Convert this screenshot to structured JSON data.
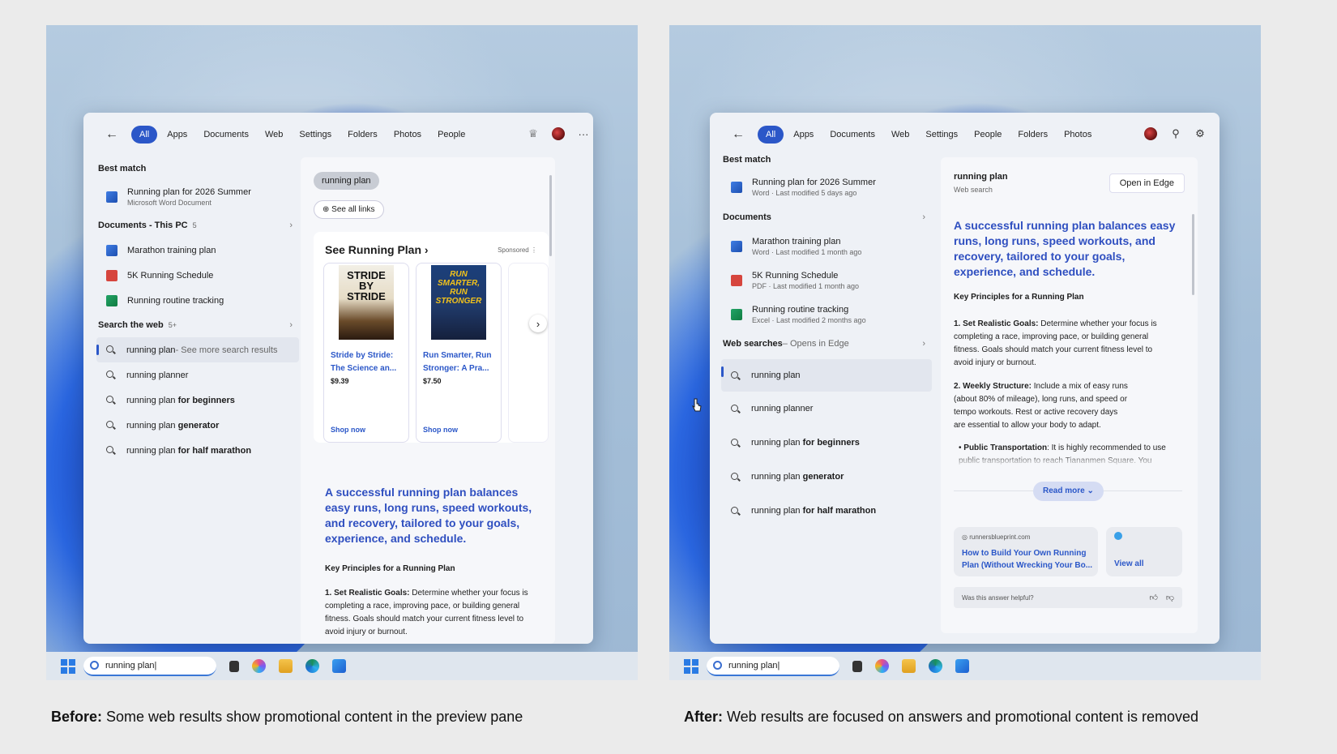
{
  "before": {
    "taskbar": {
      "search_value": "running plan|"
    },
    "filters": [
      "All",
      "Apps",
      "Documents",
      "Web",
      "Settings",
      "Folders",
      "Photos",
      "People"
    ],
    "best_match": {
      "heading": "Best match",
      "title": "Running plan for 2026 Summer",
      "subtitle": "Microsoft Word Document"
    },
    "documents": {
      "heading": "Documents - This PC",
      "count": "5",
      "items": [
        "Marathon training plan",
        "5K Running Schedule",
        "Running routine tracking"
      ]
    },
    "web": {
      "heading": "Search the web",
      "count": "5+",
      "first": "running plan",
      "first_suffix": " - See more search results",
      "items": [
        {
          "base": "running planner",
          "bold": ""
        },
        {
          "base": "running plan ",
          "bold": "for beginners"
        },
        {
          "base": "running plan ",
          "bold": "generator"
        },
        {
          "base": "running plan ",
          "bold": "for half marathon"
        }
      ]
    },
    "preview": {
      "query": "running plan",
      "see_all": "See all links",
      "ad_title": "See Running Plan",
      "sponsored": "Sponsored",
      "products": [
        {
          "cover_text": "STRIDE BY STRIDE",
          "name": "Stride by Stride: The Science an...",
          "price": "$9.39",
          "shop": "Shop now"
        },
        {
          "cover_text": "RUN SMARTER, RUN STRONGER",
          "name": "Run Smarter, Run Stronger: A Pra...",
          "price": "$7.50",
          "shop": "Shop now"
        }
      ],
      "answer": "A successful running plan balances easy runs, long runs, speed workouts, and recovery, tailored to your goals, experience, and schedule.",
      "key_principles": "Key Principles for a Running Plan",
      "p1_label": "1. Set Realistic Goals:",
      "p1_text": " Determine whether your focus is completing a race, improving pace, or building general fitness. Goals should match your current fitness level to avoid injury or burnout."
    },
    "caption_bold": "Before:",
    "caption_text": " Some web results show promotional content in the preview pane"
  },
  "after": {
    "taskbar": {
      "search_value": "running plan|"
    },
    "filters": [
      "All",
      "Apps",
      "Documents",
      "Web",
      "Settings",
      "People",
      "Folders",
      "Photos"
    ],
    "best_match": {
      "heading": "Best match",
      "title": "Running plan for 2026 Summer",
      "subtitle": "Word · Last modified 5 days ago"
    },
    "documents": {
      "heading": "Documents",
      "items": [
        {
          "title": "Marathon training plan",
          "sub": "Word · Last modified 1 month ago"
        },
        {
          "title": "5K Running Schedule",
          "sub": "PDF · Last modified 1 month ago"
        },
        {
          "title": "Running routine tracking",
          "sub": "Excel · Last modified 2 months ago"
        }
      ]
    },
    "web": {
      "heading": "Web searches",
      "heading_suffix": " – Opens in Edge",
      "items": [
        {
          "base": "running plan",
          "bold": ""
        },
        {
          "base": "running planner",
          "bold": ""
        },
        {
          "base": "running plan ",
          "bold": "for beginners"
        },
        {
          "base": "running plan ",
          "bold": "generator"
        },
        {
          "base": "running plan ",
          "bold": "for half marathon"
        }
      ]
    },
    "preview": {
      "query": "running plan",
      "query_sub": "Web search",
      "open_edge": "Open in Edge",
      "answer": "A successful running plan balances easy runs, long runs, speed workouts, and recovery, tailored to your goals, experience, and schedule.",
      "key_principles": "Key Principles for a Running Plan",
      "p1_label": "1. Set Realistic Goals:",
      "p1_text": " Determine whether your focus is completing a race, improving pace, or building general fitness. Goals should match your current fitness level to avoid injury or burnout.",
      "p2_label": "2. Weekly Structure:",
      "p2_text": " Include a mix of easy runs (about 80% of mileage), long runs, and speed or tempo workouts. Rest or active recovery days are essential to allow your body to adapt.",
      "bullet_label": "Public Transportation",
      "bullet_text": ": It is highly recommended to use public transportation to reach Tiananmen Square. You",
      "read_more": "Read more",
      "source_site": "runnersblueprint.com",
      "source_title": "How to Build Your Own Running Plan (Without Wrecking Your Bo...",
      "view_all": "View all",
      "feedback": "Was this answer helpful?"
    },
    "caption_bold": "After:",
    "caption_text": " Web results are focused on answers and promotional content is removed"
  },
  "colors": {
    "accent": "#2b57c8",
    "answer": "#2f4fc0"
  }
}
